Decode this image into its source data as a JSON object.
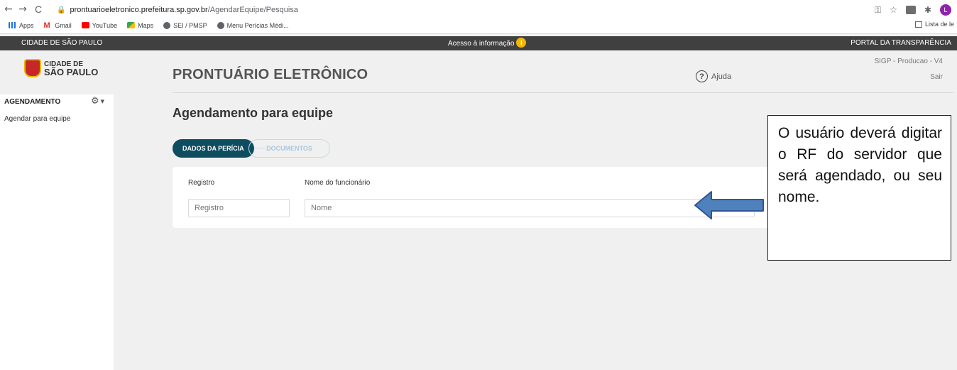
{
  "browser": {
    "back": "←",
    "forward": "→",
    "reload": "C",
    "url_domain": "prontuarioeletronico.prefeitura.sp.gov.br",
    "url_path": "/AgendarEquipe/Pesquisa",
    "profile_initial": "L"
  },
  "bookmarks": [
    {
      "label": "Apps",
      "icon": "apps-grid-icon"
    },
    {
      "label": "Gmail",
      "icon": "gmail-icon"
    },
    {
      "label": "YouTube",
      "icon": "youtube-icon"
    },
    {
      "label": "Maps",
      "icon": "maps-icon"
    },
    {
      "label": "SEI / PMSP",
      "icon": "globe-icon"
    },
    {
      "label": "Menu Perícias Médi...",
      "icon": "globe-icon"
    }
  ],
  "reading_list": "Lista de le",
  "gov_bar": {
    "left": "CIDADE DE SÃO PAULO",
    "center": "Acesso à informação",
    "info_glyph": "i",
    "right": "PORTAL DA TRANSPARÊNCIA"
  },
  "header": {
    "logo_line1": "CIDADE DE",
    "logo_line2": "SÃO PAULO",
    "title": "PRONTUÁRIO ELETRÔNICO",
    "help_glyph": "?",
    "help": "Ajuda",
    "version": "SIGP - Producao - V4",
    "logout": "Sair"
  },
  "sidebar": {
    "heading": "AGENDAMENTO",
    "gear_glyph": "⚙",
    "caret_glyph": "▼",
    "items": [
      {
        "label": "Agendar para equipe"
      }
    ]
  },
  "main": {
    "heading": "Agendamento para equipe",
    "steps": [
      {
        "label": "DADOS DA PERÍCIA",
        "active": true
      },
      {
        "label": "DOCUMENTOS",
        "active": false
      }
    ],
    "form": {
      "registro_label": "Registro",
      "registro_placeholder": "Registro",
      "nome_label": "Nome do funcionário",
      "nome_placeholder": "Nome"
    }
  },
  "annotation": {
    "text": "O usuário deverá digitar o RF do servidor que será agendado, ou seu nome.",
    "arrow_color": "#4f81bd"
  },
  "colors": {
    "accent": "#0d4d5f",
    "gov_bar": "#404040"
  }
}
